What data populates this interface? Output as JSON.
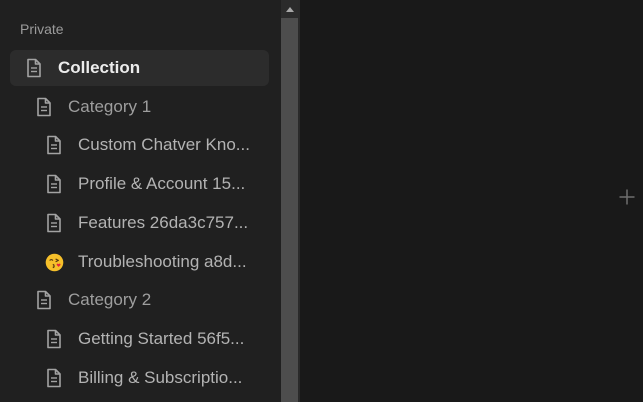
{
  "sidebar": {
    "section_label": "Private",
    "items": [
      {
        "label": "Collection",
        "icon": "page-icon",
        "level": 0,
        "active": true
      },
      {
        "label": "Category 1",
        "icon": "page-icon",
        "level": 1,
        "active": false
      },
      {
        "label": "Custom Chatver Kno...",
        "icon": "page-icon",
        "level": 2,
        "active": false
      },
      {
        "label": "Profile & Account 15...",
        "icon": "page-icon",
        "level": 2,
        "active": false
      },
      {
        "label": "Features 26da3c757...",
        "icon": "page-icon",
        "level": 2,
        "active": false
      },
      {
        "label": "Troubleshooting a8d...",
        "icon": "kissing-face-emoji-icon",
        "level": 2,
        "active": false
      },
      {
        "label": "Category 2",
        "icon": "page-icon",
        "level": 1,
        "active": false
      },
      {
        "label": "Getting Started 56f5...",
        "icon": "page-icon",
        "level": 2,
        "active": false
      },
      {
        "label": "Billing & Subscriptio...",
        "icon": "page-icon",
        "level": 2,
        "active": false
      }
    ]
  },
  "main": {
    "add_icon": "plus-icon"
  },
  "colors": {
    "sidebar_bg": "#202020",
    "main_bg": "#191919",
    "active_item_bg": "#2c2c2c",
    "text_active": "#ececec",
    "text_muted": "#9e9e9e"
  }
}
